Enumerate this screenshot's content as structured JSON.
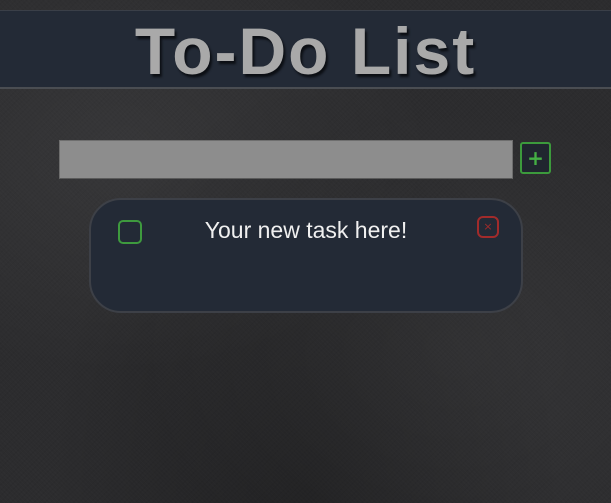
{
  "header": {
    "title": "To-Do List"
  },
  "task_input": {
    "value": "",
    "placeholder": ""
  },
  "add_button": {
    "label": "+"
  },
  "tasks": [
    {
      "text": "Your new task here!",
      "completed": false,
      "delete_label": "×"
    }
  ],
  "colors": {
    "background": "#2c2c2e",
    "header_bg": "#232a36",
    "title_text": "#a9a9a9",
    "input_bg": "#8d8d8d",
    "accent_green": "#3c9a3c",
    "delete_red": "#a12b2b",
    "task_text": "#f0f0f0"
  },
  "icons": {
    "add": "plus-icon",
    "complete": "checkbox",
    "delete": "close-icon"
  }
}
